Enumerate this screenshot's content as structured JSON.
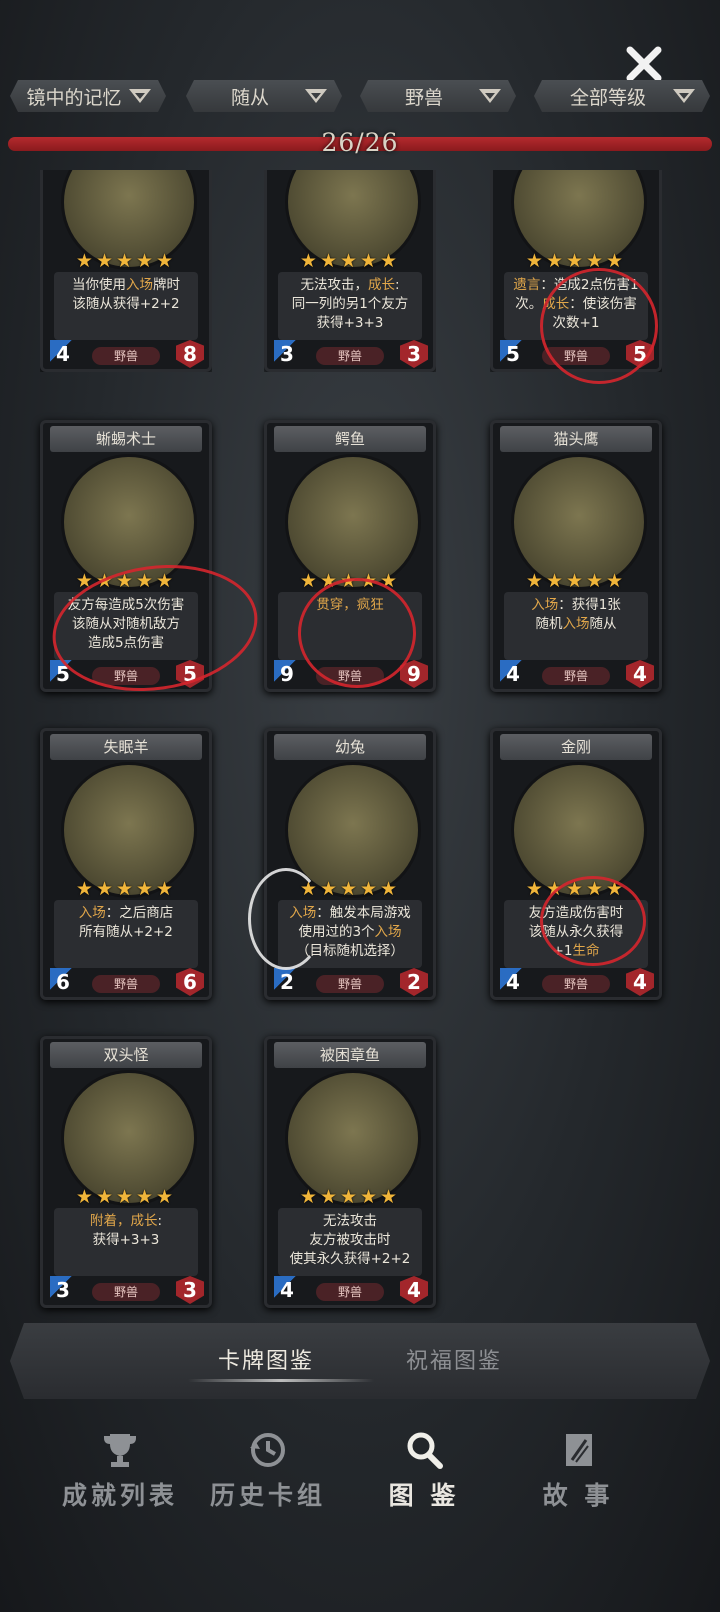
{
  "filters": [
    {
      "label": "镜中的记忆"
    },
    {
      "label": "随从"
    },
    {
      "label": "野兽"
    },
    {
      "label": "全部等级"
    }
  ],
  "progress": {
    "text": "26/26",
    "fraction": 1.0
  },
  "cards": [
    {
      "name": "",
      "stars": "★★★★★",
      "desc_html": "当你使用<span class='kw'>入场</span>牌时<br>该随从获得+2+2",
      "tag": "野兽",
      "atk": "4",
      "hp": "8"
    },
    {
      "name": "",
      "stars": "★★★★★",
      "desc_html": "无法攻击，<span class='kw'>成长</span>:<br>同一列的另1个友方<br>获得+3+3",
      "tag": "野兽",
      "atk": "3",
      "hp": "3"
    },
    {
      "name": "",
      "stars": "★★★★★",
      "desc_html": "<span class='kw'>遗言</span>：造成2点伤害1<br>次。<span class='kw'>成长</span>：使该伤害<br>次数+1",
      "tag": "野兽",
      "atk": "5",
      "hp": "5"
    },
    {
      "name": "蜥蜴术士",
      "stars": "★★★★★",
      "desc_html": "友方每造成5次伤害<br>该随从对随机敌方<br>造成5点伤害",
      "tag": "野兽",
      "atk": "5",
      "hp": "5"
    },
    {
      "name": "鳄鱼",
      "stars": "★★★★★",
      "desc_html": "<span class='kw'>贯穿，疯狂</span>",
      "tag": "野兽",
      "atk": "9",
      "hp": "9"
    },
    {
      "name": "猫头鹰",
      "stars": "★★★★★",
      "desc_html": "<span class='kw'>入场</span>：获得1张<br>随机<span class='kw'>入场</span>随从",
      "tag": "野兽",
      "atk": "4",
      "hp": "4"
    },
    {
      "name": "失眠羊",
      "stars": "★★★★★",
      "desc_html": "<span class='kw'>入场</span>：之后商店<br>所有随从+2+2",
      "tag": "野兽",
      "atk": "6",
      "hp": "6"
    },
    {
      "name": "幼兔",
      "stars": "★★★★★",
      "desc_html": "<span class='kw'>入场</span>：触发本局游戏<br>使用过的3个<span class='kw'>入场</span><br>（目标随机选择）",
      "tag": "野兽",
      "atk": "2",
      "hp": "2"
    },
    {
      "name": "金刚",
      "stars": "★★★★★",
      "desc_html": "友方造成伤害时<br>该随从永久获得<br>+1<span class='kw'>生命</span>",
      "tag": "野兽",
      "atk": "4",
      "hp": "4"
    },
    {
      "name": "双头怪",
      "stars": "★★★★★",
      "desc_html": "<span class='kw'>附着，成长</span>:<br>获得+3+3",
      "tag": "野兽",
      "atk": "3",
      "hp": "3"
    },
    {
      "name": "被困章鱼",
      "stars": "★★★★★",
      "desc_html": "无法攻击<br>友方被攻击时<br>使其永久获得+2+2",
      "tag": "野兽",
      "atk": "4",
      "hp": "4"
    }
  ],
  "sub_tabs": {
    "active": "卡牌图鉴",
    "inactive": "祝福图鉴"
  },
  "nav": [
    {
      "label": "成就列表",
      "icon": "trophy-icon"
    },
    {
      "label": "历史卡组",
      "icon": "history-icon"
    },
    {
      "label": "图 鉴",
      "icon": "magnifier-icon"
    },
    {
      "label": "故 事",
      "icon": "book-icon"
    }
  ],
  "colors": {
    "accent_red": "#b52a2e",
    "star": "#f0b53a",
    "keyword": "#e0a64a",
    "attack_blue": "#2a6cc2",
    "health_red": "#a3262b"
  }
}
